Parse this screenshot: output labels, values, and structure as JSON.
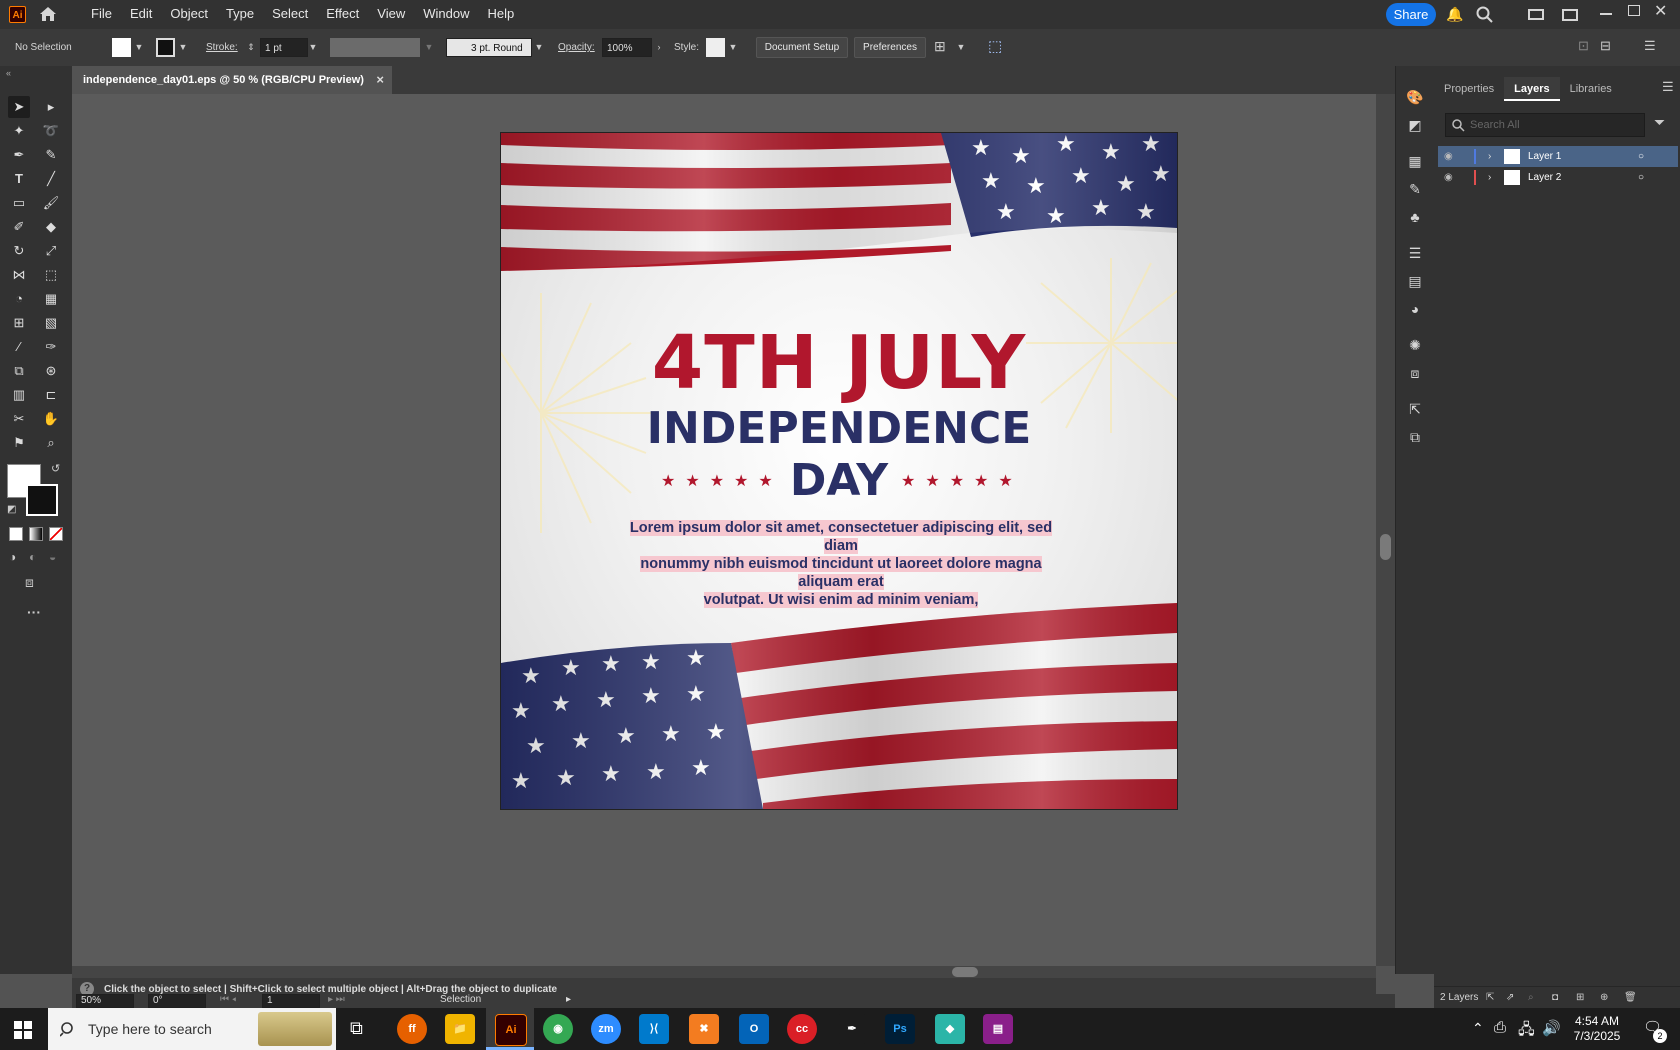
{
  "app": {
    "logo": "Ai",
    "menus": [
      "File",
      "Edit",
      "Object",
      "Type",
      "Select",
      "Effect",
      "View",
      "Window",
      "Help"
    ],
    "share_label": "Share"
  },
  "control_bar": {
    "selection": "No Selection",
    "stroke_label": "Stroke:",
    "stroke_value": "1 pt",
    "brush": "3 pt. Round",
    "opacity_label": "Opacity:",
    "opacity_value": "100%",
    "style_label": "Style:",
    "document_setup": "Document Setup",
    "preferences": "Preferences"
  },
  "document": {
    "tab_title": "independence_day01.eps @ 50 % (RGB/CPU Preview)",
    "close": "×"
  },
  "artwork": {
    "headline": "4TH JULY",
    "subtitle_1": "INDEPENDENCE",
    "subtitle_2": "DAY",
    "stars_left": "★★★★★",
    "stars_right": "★★★★★",
    "body_line_1": "Lorem ipsum dolor sit amet, consectetuer adipiscing elit, sed diam",
    "body_line_2": "nonummy nibh euismod tincidunt ut laoreet dolore magna aliquam erat",
    "body_line_3": "volutpat. Ut wisi enim ad minim veniam,",
    "colors": {
      "red": "#b1172d",
      "navy": "#2a3066",
      "highlight": "#f6c7cf"
    }
  },
  "panel": {
    "tabs": [
      "Properties",
      "Layers",
      "Libraries"
    ],
    "active_tab": "Layers",
    "search_placeholder": "Search All",
    "layers": [
      {
        "name": "Layer 1",
        "color": "#4f7ae0",
        "selected": true
      },
      {
        "name": "Layer 2",
        "color": "#e04f4f",
        "selected": false
      }
    ],
    "layer_count": "2 Layers"
  },
  "status": {
    "hint": "Click the object to select  |  Shift+Click to select multiple object  |  Alt+Drag the object to duplicate",
    "zoom": "50%",
    "rotation": "0°",
    "artboard": "1",
    "tool": "Selection"
  },
  "taskbar": {
    "search_placeholder": "Type here to search",
    "time": "4:54 AM",
    "date": "7/3/2025",
    "notifications": "2"
  }
}
